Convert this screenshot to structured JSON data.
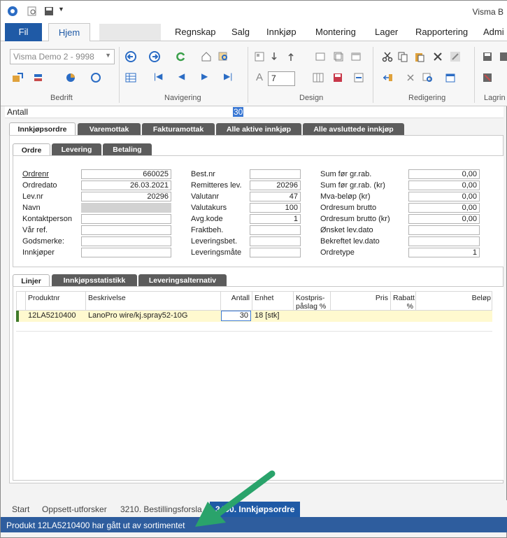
{
  "window": {
    "title": "Visma B"
  },
  "menu": {
    "file": "Fil",
    "home": "Hjem",
    "items": [
      "Regnskap",
      "Salg",
      "Innkjøp",
      "Montering",
      "Lager",
      "Rapportering",
      "Admi"
    ]
  },
  "ribbon": {
    "company_combo": "Visma Demo 2 - 9998",
    "font_size_value": "7",
    "groups": [
      "Bedrift",
      "Navigering",
      "Design",
      "Redigering",
      "Lagrin"
    ]
  },
  "command_bar": {
    "label": "Antall",
    "value": "30"
  },
  "main_tabs": [
    "Innkjøpsordre",
    "Varemottak",
    "Fakturamottak",
    "Alle aktive innkjøp",
    "Alle avsluttede innkjøp"
  ],
  "sub_tabs": [
    "Ordre",
    "Levering",
    "Betaling"
  ],
  "form": {
    "col1": [
      {
        "label": "Ordrenr",
        "value": "660025"
      },
      {
        "label": "Ordredato",
        "value": "26.03.2021"
      },
      {
        "label": "Lev.nr",
        "value": "20296"
      },
      {
        "label": "Navn",
        "value": ""
      },
      {
        "label": "Kontaktperson",
        "value": ""
      },
      {
        "label": "Vår ref.",
        "value": ""
      },
      {
        "label": "Godsmerke:",
        "value": ""
      },
      {
        "label": "Innkjøper",
        "value": ""
      }
    ],
    "col2": [
      {
        "label": "Best.nr",
        "value": ""
      },
      {
        "label": "Remitteres lev.",
        "value": "20296"
      },
      {
        "label": "Valutanr",
        "value": "47"
      },
      {
        "label": "Valutakurs",
        "value": "100"
      },
      {
        "label": "Avg.kode",
        "value": "1"
      },
      {
        "label": "Fraktbeh.",
        "value": ""
      },
      {
        "label": "Leveringsbet.",
        "value": ""
      },
      {
        "label": "Leveringsmåte",
        "value": ""
      }
    ],
    "col3": [
      {
        "label": "Sum før gr.rab.",
        "value": "0,00"
      },
      {
        "label": "Sum før gr.rab. (kr)",
        "value": "0,00"
      },
      {
        "label": "Mva-beløp (kr)",
        "value": "0,00"
      },
      {
        "label": "Ordresum brutto",
        "value": "0,00"
      },
      {
        "label": "Ordresum brutto (kr)",
        "value": "0,00"
      },
      {
        "label": "Ønsket lev.dato",
        "value": ""
      },
      {
        "label": "Bekreftet lev.dato",
        "value": ""
      },
      {
        "label": "Ordretype",
        "value": "1"
      }
    ]
  },
  "line_tabs": [
    "Linjer",
    "Innkjøpsstatistikk",
    "Leveringsalternativ"
  ],
  "grid": {
    "headers": [
      "Produktnr",
      "Beskrivelse",
      "Antall",
      "Enhet",
      "Kostpris-påslag %",
      "Pris",
      "Rabatt %",
      "Beløp"
    ],
    "rows": [
      {
        "produktnr": "12LA5210400",
        "beskrivelse": "LanoPro wire/kj.spray52-10G",
        "antall": "30",
        "enhet": "18 [stk]"
      }
    ]
  },
  "bottom_tabs": [
    "Start",
    "Oppsett-utforsker",
    "3210. Bestillingsforsla",
    "3400. Innkjøpsordre"
  ],
  "status": {
    "message": "Produkt 12LA5210400 har gått ut av sortimentet"
  }
}
